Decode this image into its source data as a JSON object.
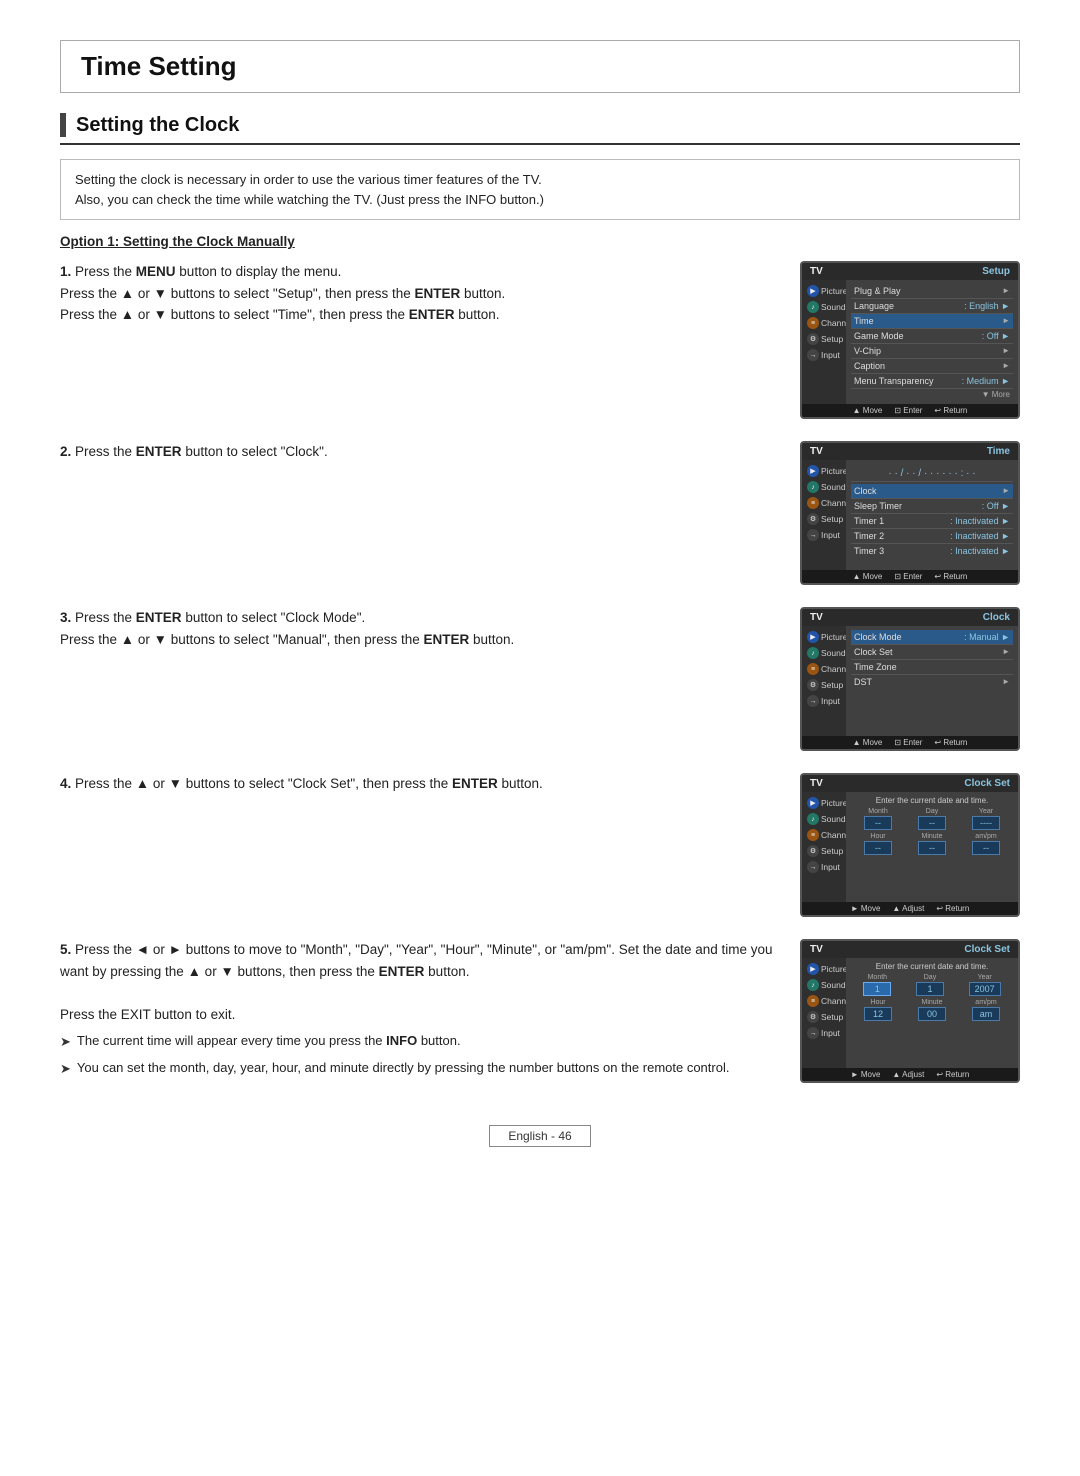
{
  "page": {
    "title": "Time Setting",
    "section_title": "Setting the Clock",
    "intro_line1": "Setting the clock is necessary in order to use the various timer features of the TV.",
    "intro_line2": "Also, you can check the time while watching the TV. (Just press the INFO button.)",
    "option_heading": "Option 1: Setting the Clock Manually",
    "steps": [
      {
        "num": "1.",
        "text_parts": [
          {
            "text": "Press the ",
            "bold": false
          },
          {
            "text": "MENU",
            "bold": true
          },
          {
            "text": " button to display the menu.",
            "bold": false
          },
          {
            "text": "\nPress the ▲ or ▼ buttons to select \"Setup\", then press the ",
            "bold": false
          },
          {
            "text": "ENTER",
            "bold": true
          },
          {
            "text": " button.",
            "bold": false
          },
          {
            "text": "\nPress the ▲ or ▼ buttons to select \"Time\", then press the ",
            "bold": false
          },
          {
            "text": "ENTER",
            "bold": true
          },
          {
            "text": " button.",
            "bold": false
          }
        ],
        "screen": "setup"
      },
      {
        "num": "2.",
        "text_parts": [
          {
            "text": "Press the ",
            "bold": false
          },
          {
            "text": "ENTER",
            "bold": true
          },
          {
            "text": " button to select \"Clock\".",
            "bold": false
          }
        ],
        "screen": "time"
      },
      {
        "num": "3.",
        "text_parts": [
          {
            "text": "Press the ",
            "bold": false
          },
          {
            "text": "ENTER",
            "bold": true
          },
          {
            "text": " button to select \"Clock Mode\".",
            "bold": false
          },
          {
            "text": "\nPress the ▲ or ▼ buttons to select \"Manual\", then press the ",
            "bold": false
          },
          {
            "text": "ENTER",
            "bold": true
          },
          {
            "text": " button.",
            "bold": false
          }
        ],
        "screen": "clock"
      },
      {
        "num": "4.",
        "text_parts": [
          {
            "text": "Press the ▲ or ▼ buttons to select \"Clock Set\", then press the ",
            "bold": false
          },
          {
            "text": "ENTER",
            "bold": true
          },
          {
            "text": " button.",
            "bold": false
          }
        ],
        "screen": "clockset1"
      },
      {
        "num": "5.",
        "text_parts": [
          {
            "text": "Press the ◄ or ► buttons to move to \"Month\", \"Day\", \"Year\", \"Hour\", \"Minute\",\nor \"am/pm\". Set the date and time you want by pressing the ▲ or ▼ buttons,\nthen press the ",
            "bold": false
          },
          {
            "text": "ENTER",
            "bold": true
          },
          {
            "text": " button.",
            "bold": false
          }
        ],
        "screen": "clockset2",
        "extra_text": "Press the EXIT button to exit.",
        "notes": [
          "The current time will appear every time you press the INFO button.",
          "You can set the month, day, year, hour, and minute directly by pressing the number buttons on the remote control."
        ]
      }
    ],
    "footer": "English - 46",
    "screens": {
      "setup": {
        "tv_label": "TV",
        "title": "Setup",
        "items": [
          {
            "label": "Plug & Play",
            "value": "",
            "arrow": "►",
            "highlight": false
          },
          {
            "label": "Language",
            "value": ": English",
            "arrow": "►",
            "highlight": false
          },
          {
            "label": "Time",
            "value": "",
            "arrow": "►",
            "highlight": true
          },
          {
            "label": "Game Mode",
            "value": ": Off",
            "arrow": "►",
            "highlight": false
          },
          {
            "label": "V-Chip",
            "value": "",
            "arrow": "►",
            "highlight": false
          },
          {
            "label": "Caption",
            "value": "",
            "arrow": "►",
            "highlight": false
          },
          {
            "label": "Menu Transparency",
            "value": ": Medium",
            "arrow": "►",
            "highlight": false
          }
        ],
        "footer_items": [
          "▲ Move",
          "⊡ Enter",
          "↩ Return"
        ],
        "more": "▼ More"
      },
      "time": {
        "tv_label": "TV",
        "title": "Time",
        "clock_display": "../--/-- · · : · ·  · ·",
        "items": [
          {
            "label": "Clock",
            "value": "",
            "arrow": "►",
            "highlight": true
          },
          {
            "label": "Sleep Timer",
            "value": ": Off",
            "arrow": "►",
            "highlight": false
          },
          {
            "label": "Timer 1",
            "value": ": Inactivated",
            "arrow": "►",
            "highlight": false
          },
          {
            "label": "Timer 2",
            "value": ": Inactivated",
            "arrow": "►",
            "highlight": false
          },
          {
            "label": "Timer 3",
            "value": ": Inactivated",
            "arrow": "►",
            "highlight": false
          }
        ],
        "footer_items": [
          "▲ Move",
          "⊡ Enter",
          "↩ Return"
        ]
      },
      "clock": {
        "tv_label": "TV",
        "title": "Clock",
        "items": [
          {
            "label": "Clock Mode",
            "value": ": Manual",
            "arrow": "►",
            "highlight": true
          },
          {
            "label": "Clock Set",
            "value": "",
            "arrow": "►",
            "highlight": false
          },
          {
            "label": "Time Zone",
            "value": "",
            "arrow": "",
            "highlight": false
          },
          {
            "label": "DST",
            "value": "",
            "arrow": "►",
            "highlight": false
          }
        ],
        "footer_items": [
          "▲ Move",
          "⊡ Enter",
          "↩ Return"
        ]
      },
      "clockset1": {
        "tv_label": "TV",
        "title": "Clock Set",
        "enter_text": "Enter the current date and time.",
        "fields_row1": [
          "Month",
          "Day",
          "Year"
        ],
        "fields_row2": [
          "Hour",
          "Minute",
          "am/pm"
        ],
        "values_row1": [
          "--",
          "--",
          "----"
        ],
        "values_row2": [
          "--",
          "--",
          "--"
        ],
        "footer_items": [
          "► Move",
          "▲ Adjust",
          "↩ Return"
        ]
      },
      "clockset2": {
        "tv_label": "TV",
        "title": "Clock Set",
        "enter_text": "Enter the current date and time.",
        "fields_row1": [
          "Month",
          "Day",
          "Year"
        ],
        "fields_row2": [
          "Hour",
          "Minute",
          "am/pm"
        ],
        "values_row1": [
          "1",
          "1",
          "2007"
        ],
        "values_row2": [
          "12",
          "00",
          "am"
        ],
        "footer_items": [
          "► Move",
          "▲ Adjust",
          "↩ Return"
        ]
      }
    },
    "sidebar_items": [
      {
        "label": "Picture",
        "icon_type": "blue"
      },
      {
        "label": "Sound",
        "icon_type": "teal"
      },
      {
        "label": "Channel",
        "icon_type": "orange"
      },
      {
        "label": "Setup",
        "icon_type": "dark"
      },
      {
        "label": "Input",
        "icon_type": "dark"
      }
    ]
  }
}
